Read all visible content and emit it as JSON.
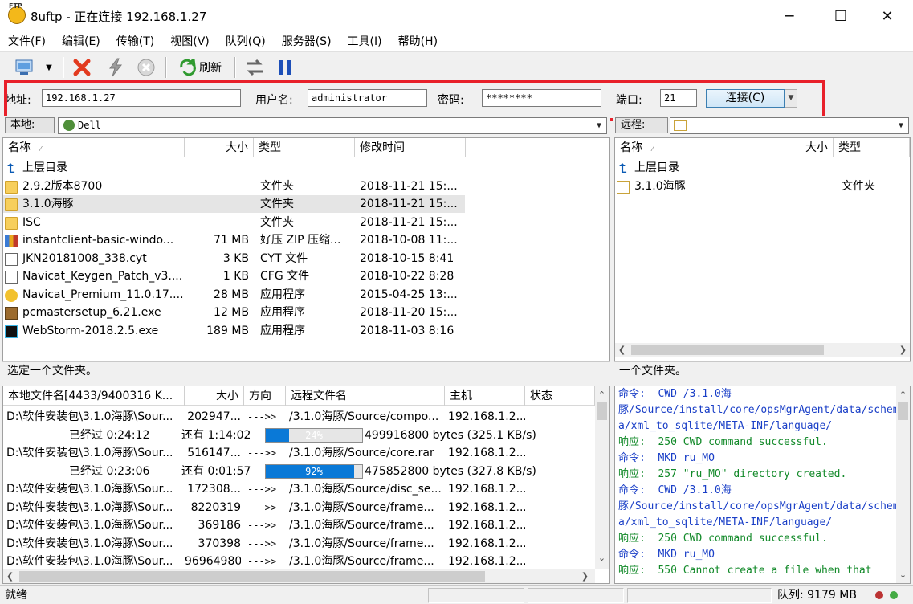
{
  "window": {
    "title": "8uftp - 正在连接 192.168.1.27",
    "icon_text": "FTP",
    "controls": {
      "minimize": "─",
      "maximize": "☐",
      "close": "✕"
    }
  },
  "menu": [
    "文件(F)",
    "编辑(E)",
    "传输(T)",
    "视图(V)",
    "队列(Q)",
    "服务器(S)",
    "工具(I)",
    "帮助(H)"
  ],
  "toolbar": {
    "refresh_label": "刷新",
    "icons": [
      "site-manager-icon",
      "disconnect-icon",
      "lightning-icon",
      "stop-icon",
      "refresh-icon",
      "transfer-icon",
      "pause-icon"
    ]
  },
  "connection": {
    "address_label": "地址:",
    "address_value": "192.168.1.27",
    "user_label": "用户名:",
    "user_value": "administrator",
    "password_label": "密码:",
    "password_value": "********",
    "port_label": "端口:",
    "port_value": "21",
    "connect_label": "连接(C)"
  },
  "local": {
    "path_label": "本地:",
    "path_value": "Dell",
    "columns": [
      "名称",
      "大小",
      "类型",
      "修改时间"
    ],
    "rows": [
      {
        "name": "上层目录",
        "size": "",
        "type": "",
        "modified": "",
        "icon": "up"
      },
      {
        "name": "2.9.2版本8700",
        "size": "",
        "type": "文件夹",
        "modified": "2018-11-21 15:...",
        "icon": "folder"
      },
      {
        "name": "3.1.0海豚",
        "size": "",
        "type": "文件夹",
        "modified": "2018-11-21 15:...",
        "icon": "folder",
        "selected": true
      },
      {
        "name": "ISC",
        "size": "",
        "type": "文件夹",
        "modified": "2018-11-21 15:...",
        "icon": "folder"
      },
      {
        "name": "instantclient-basic-windo...",
        "size": "71 MB",
        "type": "好压 ZIP 压缩...",
        "modified": "2018-10-08 11:...",
        "icon": "zip"
      },
      {
        "name": "JKN20181008_338.cyt",
        "size": "3 KB",
        "type": "CYT 文件",
        "modified": "2018-10-15 8:41",
        "icon": "file"
      },
      {
        "name": "Navicat_Keygen_Patch_v3....",
        "size": "1 KB",
        "type": "CFG 文件",
        "modified": "2018-10-22 8:28",
        "icon": "file"
      },
      {
        "name": "Navicat_Premium_11.0.17....",
        "size": "28 MB",
        "type": "应用程序",
        "modified": "2015-04-25 13:...",
        "icon": "navicat"
      },
      {
        "name": "pcmastersetup_6.21.exe",
        "size": "12 MB",
        "type": "应用程序",
        "modified": "2018-11-20 15:...",
        "icon": "pcmaster"
      },
      {
        "name": "WebStorm-2018.2.5.exe",
        "size": "189 MB",
        "type": "应用程序",
        "modified": "2018-11-03 8:16",
        "icon": "webstorm"
      }
    ],
    "status": "选定一个文件夹。"
  },
  "remote": {
    "path_label": "远程:",
    "path_value": "",
    "columns": [
      "名称",
      "大小",
      "类型"
    ],
    "rows": [
      {
        "name": "上层目录",
        "size": "",
        "type": "",
        "icon": "up"
      },
      {
        "name": "3.1.0海豚",
        "size": "",
        "type": "文件夹",
        "icon": "folder-outline"
      }
    ],
    "status": "一个文件夹。"
  },
  "queue": {
    "columns": [
      "本地文件名[4433/9400316 K...",
      "大小",
      "方向",
      "远程文件名",
      "主机",
      "状态"
    ],
    "rows": [
      {
        "kind": "file",
        "local": "D:\\软件安装包\\3.1.0海豚\\Sour...",
        "size": "202947...",
        "dir": "--->>",
        "remote": "/3.1.0海豚/Source/compo...",
        "host": "192.168.1.2..."
      },
      {
        "kind": "progress",
        "elapsed": "已经过 0:24:12",
        "remaining": "还有 1:14:02",
        "percent": 24,
        "percent_label": "24%",
        "bytes": "499916800 bytes (325.1 KB/s)"
      },
      {
        "kind": "file",
        "local": "D:\\软件安装包\\3.1.0海豚\\Sour...",
        "size": "516147...",
        "dir": "--->>",
        "remote": "/3.1.0海豚/Source/core.rar",
        "host": "192.168.1.2..."
      },
      {
        "kind": "progress",
        "elapsed": "已经过 0:23:06",
        "remaining": "还有 0:01:57",
        "percent": 92,
        "percent_label": "92%",
        "bytes": "475852800 bytes (327.8 KB/s)"
      },
      {
        "kind": "file",
        "local": "D:\\软件安装包\\3.1.0海豚\\Sour...",
        "size": "172308...",
        "dir": "--->>",
        "remote": "/3.1.0海豚/Source/disc_se...",
        "host": "192.168.1.2..."
      },
      {
        "kind": "file",
        "local": "D:\\软件安装包\\3.1.0海豚\\Sour...",
        "size": "8220319",
        "dir": "--->>",
        "remote": "/3.1.0海豚/Source/frame...",
        "host": "192.168.1.2..."
      },
      {
        "kind": "file",
        "local": "D:\\软件安装包\\3.1.0海豚\\Sour...",
        "size": "369186",
        "dir": "--->>",
        "remote": "/3.1.0海豚/Source/frame...",
        "host": "192.168.1.2..."
      },
      {
        "kind": "file",
        "local": "D:\\软件安装包\\3.1.0海豚\\Sour...",
        "size": "370398",
        "dir": "--->>",
        "remote": "/3.1.0海豚/Source/frame...",
        "host": "192.168.1.2..."
      },
      {
        "kind": "file",
        "local": "D:\\软件安装包\\3.1.0海豚\\Sour...",
        "size": "96964980",
        "dir": "--->>",
        "remote": "/3.1.0海豚/Source/frame...",
        "host": "192.168.1.2..."
      }
    ]
  },
  "log": [
    {
      "type": "cmd",
      "text": "命令:  CWD /3.1.0海"
    },
    {
      "type": "cmd",
      "text": "豚/Source/install/core/opsMgrAgent/data/schem"
    },
    {
      "type": "cmd",
      "text": "a/xml_to_sqlite/META-INF/language/"
    },
    {
      "type": "resp",
      "text": "响应:  250 CWD command successful."
    },
    {
      "type": "cmd",
      "text": "命令:  MKD ru_MO"
    },
    {
      "type": "resp",
      "text": "响应:  257 \"ru_MO\" directory created."
    },
    {
      "type": "cmd",
      "text": "命令:  CWD /3.1.0海"
    },
    {
      "type": "cmd",
      "text": "豚/Source/install/core/opsMgrAgent/data/schem"
    },
    {
      "type": "cmd",
      "text": "a/xml_to_sqlite/META-INF/language/"
    },
    {
      "type": "resp",
      "text": "响应:  250 CWD command successful."
    },
    {
      "type": "cmd",
      "text": "命令:  MKD ru_MO"
    },
    {
      "type": "resp",
      "text": "响应:  550 Cannot create a file when that"
    }
  ],
  "statusbar": {
    "ready": "就绪",
    "queue": "队列: 9179 MB"
  },
  "colors": {
    "highlight_box": "#e8202a",
    "progress_fill": "#0a79d7",
    "log_command": "#1a3fc7",
    "log_response": "#138a2a",
    "selected_row": "#e5e5e5"
  }
}
